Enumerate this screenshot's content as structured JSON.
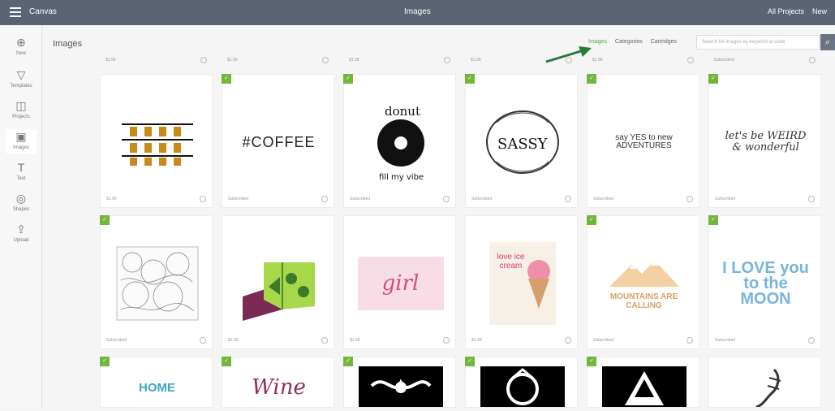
{
  "topbar": {
    "brand": "Canvas",
    "title": "Images",
    "project": "All Projects",
    "new_label": "New"
  },
  "sidebar": {
    "items": [
      {
        "label": "New",
        "icon": "plus-icon"
      },
      {
        "label": "Templates",
        "icon": "shirt-icon"
      },
      {
        "label": "Projects",
        "icon": "folder-icon"
      },
      {
        "label": "Images",
        "icon": "image-icon"
      },
      {
        "label": "Text",
        "icon": "text-icon"
      },
      {
        "label": "Shapes",
        "icon": "shape-icon"
      },
      {
        "label": "Upload",
        "icon": "upload-icon"
      }
    ]
  },
  "page": {
    "title": "Images",
    "filters": [
      "Images",
      "Categories",
      "Cartridges"
    ],
    "search_placeholder": "Search for images by keyword or code"
  },
  "tiles": [
    {
      "label": "$1.99",
      "text": ""
    },
    {
      "label": "Subscribed",
      "text": "#COFFEE"
    },
    {
      "label": "Subscribed",
      "text": "donut"
    },
    {
      "label": "Subscribed",
      "text": "SASSY"
    },
    {
      "label": "Subscribed",
      "text": "say YES to new ADVENTURES"
    },
    {
      "label": "Subscribed",
      "text": "let's be WEIRD & wonderful"
    },
    {
      "label": "Subscribed",
      "text": ""
    },
    {
      "label": "$1.99",
      "text": ""
    },
    {
      "label": "$1.99",
      "text": "girl"
    },
    {
      "label": "$1.99",
      "text": "love ice cream"
    },
    {
      "label": "Subscribed",
      "text": "MOUNTAINS ARE CALLING"
    },
    {
      "label": "Subscribed",
      "text": "I LOVE you to the MOON"
    },
    {
      "label": "",
      "text": "HOME"
    },
    {
      "label": "",
      "text": "Wine"
    },
    {
      "label": "",
      "text": ""
    },
    {
      "label": "",
      "text": ""
    },
    {
      "label": "",
      "text": ""
    },
    {
      "label": "",
      "text": ""
    }
  ],
  "top_row_labels": [
    "$1.99",
    "$1.99",
    "$1.99",
    "$1.99",
    "$1.99",
    "Subscribed"
  ],
  "colors": {
    "topbar": "#5a6472",
    "green_badge": "#72b73b",
    "accent_green": "#47b047"
  }
}
